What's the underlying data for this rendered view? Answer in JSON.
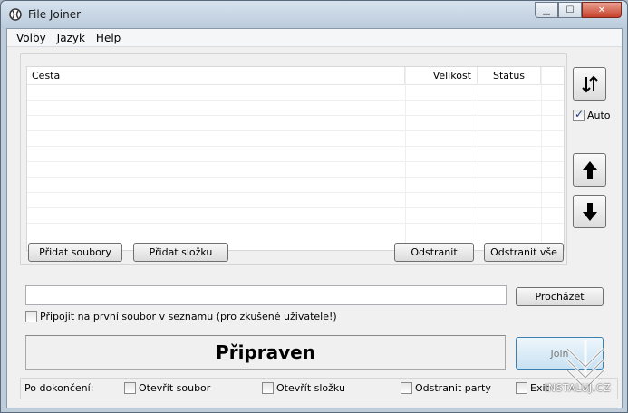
{
  "window": {
    "title": "File Joiner"
  },
  "menu": [
    "Volby",
    "Jazyk",
    "Help"
  ],
  "list": {
    "columns": [
      "Cesta",
      "Velikost",
      "Status"
    ],
    "rows": []
  },
  "buttons": {
    "add_files": "Přidat soubory",
    "add_folder": "Přidat složku",
    "remove": "Odstranit",
    "remove_all": "Odstranit vše",
    "browse": "Procházet",
    "join": "Join"
  },
  "side": {
    "auto_label": "Auto",
    "auto_checked": true
  },
  "output": {
    "path_value": "",
    "append_label": "Připojit na první soubor v seznamu (pro zkušené uživatele!)",
    "append_checked": false
  },
  "status": {
    "text": "Připraven"
  },
  "after_finish": {
    "label": "Po dokončení:",
    "options": [
      {
        "label": "Otevřít soubor",
        "checked": false
      },
      {
        "label": "Otevřít složku",
        "checked": false
      },
      {
        "label": "Odstranit party",
        "checked": false
      },
      {
        "label": "Exit",
        "checked": false
      }
    ]
  },
  "watermark": {
    "text": "INSTALUJ.CZ"
  }
}
